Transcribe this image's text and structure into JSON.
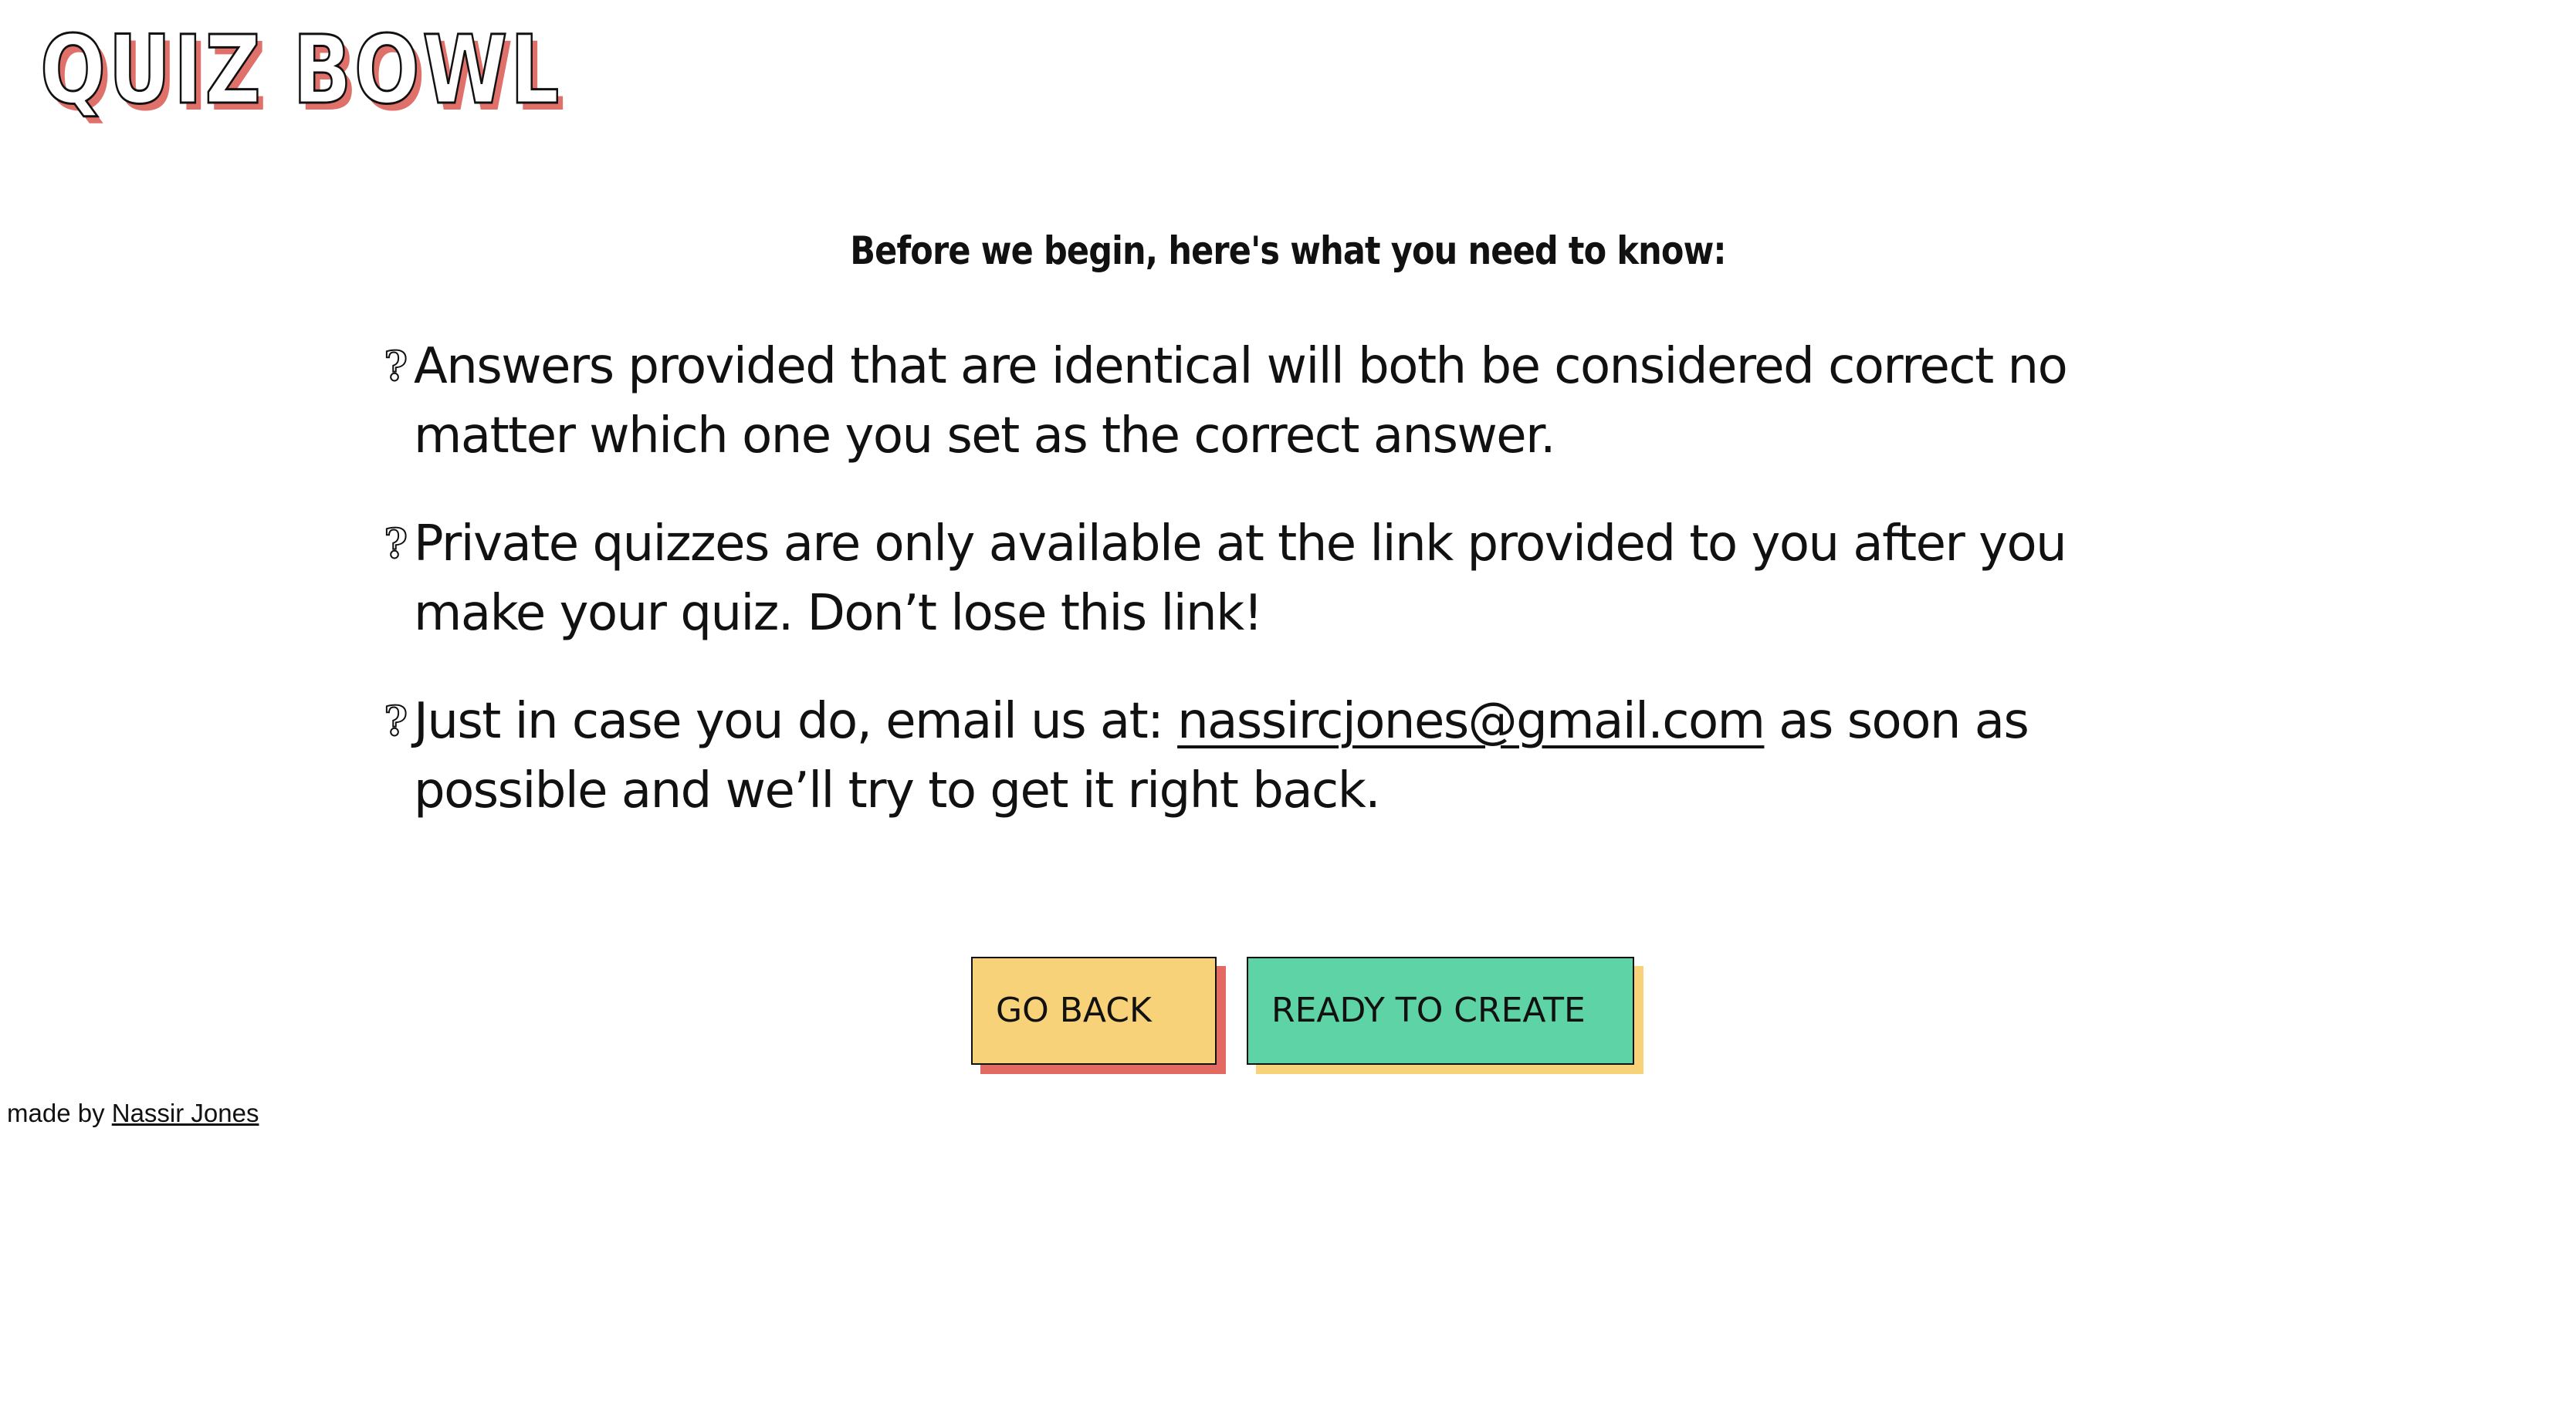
{
  "header": {
    "logo_text": "QUIZ BOWL"
  },
  "intro": {
    "heading": "Before we begin, here's what you need to know:"
  },
  "rules": {
    "icon": "question-mark-icon",
    "items": [
      {
        "text": "Answers provided that are identical will both be considered correct no matter which one you set as the correct answer."
      },
      {
        "text": "Private quizzes are only available at the link provided to you after you make your quiz. Don’t lose this link!"
      },
      {
        "text_before": "Just in case you do, email us at: ",
        "email": "nassircjones@gmail.com",
        "text_after": " as soon as possible and we’ll try to get it right back."
      }
    ]
  },
  "actions": {
    "go_back_label": "GO BACK",
    "ready_label": "READY TO CREATE"
  },
  "footer": {
    "prefix": "made by ",
    "author": "Nassir Jones"
  },
  "colors": {
    "yellow": "#f8d279",
    "green": "#5ed3a5",
    "red_shadow": "#e36a63"
  }
}
